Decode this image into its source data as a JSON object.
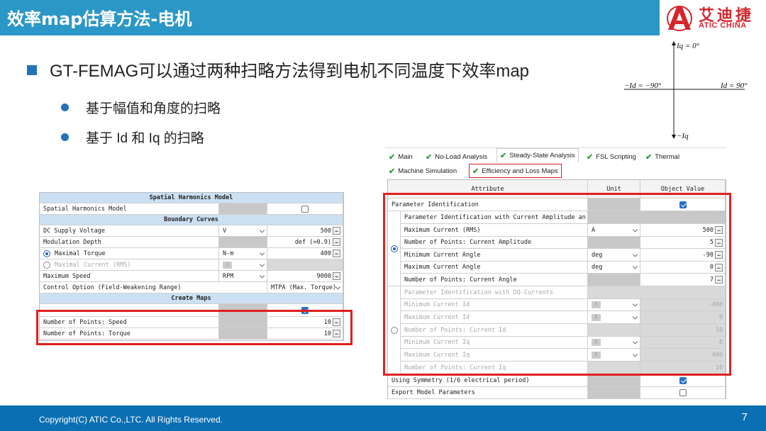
{
  "slide": {
    "title": "效率map估算方法-电机",
    "logo_cn": "艾迪捷",
    "logo_en": "ATIC CHINA",
    "bullet_main": "GT-FEMAG可以通过两种扫略方法得到电机不同温度下效率map",
    "bullet_sub1": "基于幅值和角度的扫略",
    "bullet_sub2": "基于 Id 和 Iq 的扫略",
    "footer": "Copyright(C) ATIC Co.,LTC. All Rights Reserved.",
    "page_number": "7"
  },
  "diagram": {
    "iq_pos": "Iq = 0°",
    "id_neg": "−Id = −90°",
    "id_pos": "Id = 90°",
    "iq_neg": "−Iq"
  },
  "left_grid": {
    "sec1": "Spatial Harmonics Model",
    "spatial_harmonics_label": "Spatial Harmonics Model",
    "sec2": "Boundary Curves",
    "dc_label": "DC Supply Voltage",
    "dc_unit": "V",
    "dc_value": "500",
    "mod_label": "Modulation Depth",
    "mod_value": "def (=0.9)",
    "torque_label": "Maximal Torque",
    "torque_unit": "N-m",
    "torque_value": "400",
    "current_label": "Maximal Current (RMS)",
    "current_unit": "A",
    "speed_label": "Maximum Speed",
    "speed_unit": "RPM",
    "speed_value": "9000",
    "control_label": "Control Option (Field-Weakening Range)",
    "control_value": "MTPA (Max. Torque)",
    "sec3": "Create Maps",
    "pts_speed_label": "Number of Points: Speed",
    "pts_speed_value": "10",
    "pts_torque_label": "Number of Points: Torque",
    "pts_torque_value": "10"
  },
  "tabs": {
    "main": "Main",
    "noload": "No-Load Analysis",
    "steady": "Steady-State Analysis",
    "fsl": "FSL Scripting",
    "thermal": "Thermal",
    "machine": "Machine Simulation",
    "efficiency": "Efficiency and Loss Maps"
  },
  "right_grid": {
    "col_attribute": "Attribute",
    "col_unit": "Unit",
    "col_value": "Object Value",
    "param_ident": "Parameter Identification",
    "amp_header": "Parameter Identification with Current Amplitude an...",
    "max_current_label": "Maximum Current (RMS)",
    "max_current_unit": "A",
    "max_current_value": "500",
    "pts_amp_label": "Number of Points: Current Amplitude",
    "pts_amp_value": "5",
    "min_angle_label": "Minimum Current Angle",
    "min_angle_unit": "deg",
    "min_angle_value": "-90",
    "max_angle_label": "Maximum Current Angle",
    "max_angle_unit": "deg",
    "max_angle_value": "0",
    "pts_angle_label": "Number of Points: Current Angle",
    "pts_angle_value": "7",
    "dq_header": "Parameter Identification with DQ-Currents",
    "min_id_label": "Minimum Current Id",
    "min_id_unit": "A",
    "min_id_value": "-400",
    "max_id_label": "Maximum Current Id",
    "max_id_unit": "A",
    "max_id_value": "0",
    "pts_id_label": "Number of Points: Current Id",
    "pts_id_value": "10",
    "min_iq_label": "Minimum Current Iq",
    "min_iq_unit": "A",
    "min_iq_value": "0",
    "max_iq_label": "Maximum Current Iq",
    "max_iq_unit": "A",
    "max_iq_value": "400",
    "pts_iq_label": "Number of Points: Current Iq",
    "pts_iq_value": "10",
    "symmetry_label": "Using Symmetry (1/6 electrical period)",
    "export_label": "Export Model Parameters"
  },
  "colors": {
    "header_bg": "#2b97c7",
    "footer_bg": "#0b6fb3",
    "accent_red": "#e02020",
    "bullet_blue": "#2473b8"
  }
}
